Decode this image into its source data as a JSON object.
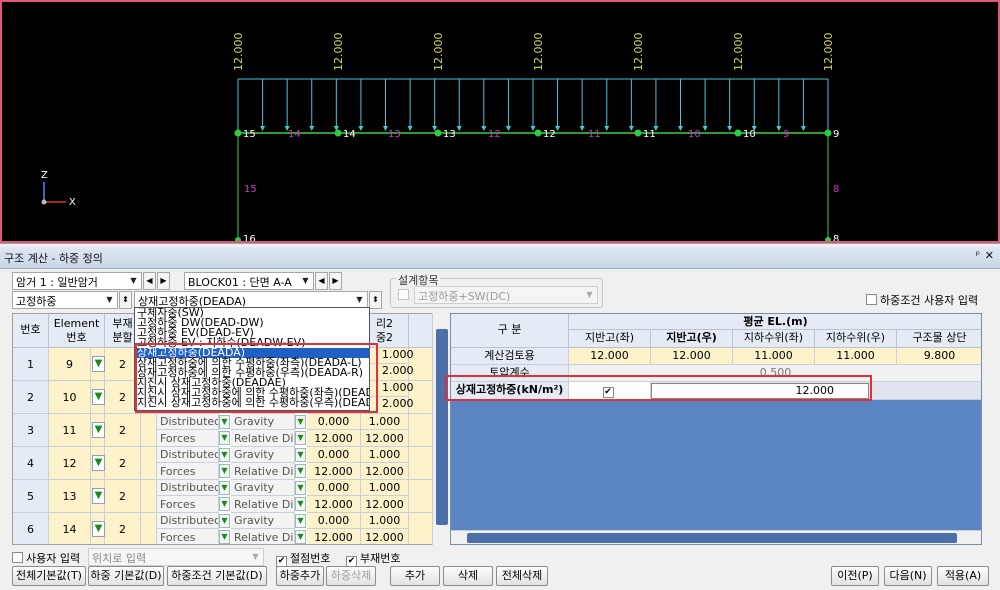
{
  "viewport": {
    "load_value": "12.000",
    "node_labels": [
      "15",
      "14",
      "13",
      "12",
      "11",
      "10",
      "9"
    ],
    "member_labels": [
      "14",
      "13",
      "12",
      "11",
      "10",
      "9"
    ],
    "left_col": {
      "member": "15",
      "node": "16"
    },
    "right_col": {
      "member": "8",
      "node": "8"
    },
    "axis": {
      "z": "Z",
      "x": "X"
    },
    "colors": {
      "load": "#45c8d8",
      "member": "#3ad03a",
      "node": "#2ecc40",
      "label": "#cc33cc",
      "text": "#d8d840"
    }
  },
  "panel": {
    "title": "구조 계산 - 하중 정의",
    "pin": "ᵖ",
    "close": "✕",
    "culvert_combo": "암거 1 : 일반암거",
    "block_combo": "BLOCK01 : 단면 A-A",
    "design_group_label": "설계항목",
    "design_combo": "고정하중+SW(DC)",
    "load_type_combo": "고정하중",
    "load_case_combo": "상재고정하중(DEADA)",
    "user_input_check": "하중조건 사용자 입력"
  },
  "dropdown": {
    "items": [
      "구체자중(SW)",
      "고정하중 DW(DEAD-DW)",
      "고정하중 EV(DEAD-EV)",
      "고정하중 EV : 지하수(DEADW-EV)",
      "상재고정하중(DEADA)",
      "상재고정하중에 의한 수평하중(좌측)(DEADA-L)",
      "상재고정하중에 의한 수평하중(우측)(DEADA-R)",
      "지진시 상재고정하중(DEADAE)",
      "지진시 상재고정하중에 의한 수평하중(좌측)(DEAD",
      "지진시 상재고정하중에 의한 수평하중(우측)(DEAD"
    ],
    "selected_index": 4
  },
  "left_grid": {
    "headers": {
      "no": "번호",
      "element": "Element",
      "element2": "번호",
      "div": "부재",
      "div2": "분할",
      "dist1": "리2",
      "dist2": "중2"
    },
    "rows": [
      {
        "no": "1",
        "element": "9",
        "div": "2",
        "type1": "",
        "type2": "",
        "dir1": "",
        "dir2": "",
        "v1": "",
        "v2": "",
        "v3": "",
        "v4": ""
      },
      {
        "no": "2",
        "element": "10",
        "div": "2",
        "type1": "",
        "type2": "",
        "dir1": "",
        "dir2": "",
        "v1": "",
        "v2": "",
        "v3": "",
        "v4": ""
      },
      {
        "no": "3",
        "element": "11",
        "div": "2",
        "type1": "Distributed",
        "type2": "Forces",
        "dir1": "Gravity",
        "dir2": "Relative Dist",
        "v1": "0.000",
        "v2": "12.000",
        "v3": "1.000",
        "v4": "12.000"
      },
      {
        "no": "4",
        "element": "12",
        "div": "2",
        "type1": "Distributed",
        "type2": "Forces",
        "dir1": "Gravity",
        "dir2": "Relative Dist",
        "v1": "0.000",
        "v2": "12.000",
        "v3": "1.000",
        "v4": "12.000"
      },
      {
        "no": "5",
        "element": "13",
        "div": "2",
        "type1": "Distributed",
        "type2": "Forces",
        "dir1": "Gravity",
        "dir2": "Relative Dist",
        "v1": "0.000",
        "v2": "12.000",
        "v3": "1.000",
        "v4": "12.000"
      },
      {
        "no": "6",
        "element": "14",
        "div": "2",
        "type1": "Distributed",
        "type2": "Forces",
        "dir1": "Gravity",
        "dir2": "Relative Dist",
        "v1": "0.000",
        "v2": "12.000",
        "v3": "1.000",
        "v4": "12.000"
      }
    ],
    "partial_vals": [
      "1.000",
      "2.000",
      "1.000",
      "2.000"
    ]
  },
  "right_grid": {
    "section_header": "구 분",
    "group_header": "평균 EL.(m)",
    "columns": [
      "지반고(좌)",
      "지반고(우)",
      "지하수위(좌)",
      "지하수위(우)",
      "구조물 상단"
    ],
    "rows": [
      {
        "label": "계산검토용",
        "values": [
          "12.000",
          "12.000",
          "11.000",
          "11.000",
          "9.800"
        ]
      },
      {
        "label": "토압계수",
        "merged": "0.500"
      },
      {
        "label": "상재고정하중(kN/m²)",
        "check": "✔",
        "value": "12.000"
      }
    ]
  },
  "bottom": {
    "user_input": "사용자 입력",
    "position_combo": "위치로 입력",
    "node_no": "절점번호",
    "member_no": "부재번호",
    "btn_default_all": "전체기본값(T)",
    "btn_default_load": "하중 기본값(D)",
    "btn_default_cond": "하중조건 기본값(D)",
    "btn_add_load": "하중추가",
    "btn_del_load": "하중삭제",
    "btn_add": "추가",
    "btn_del": "삭제",
    "btn_del_all": "전체삭제",
    "btn_prev": "이전(P)",
    "btn_next": "다음(N)",
    "btn_apply": "적용(A)"
  }
}
